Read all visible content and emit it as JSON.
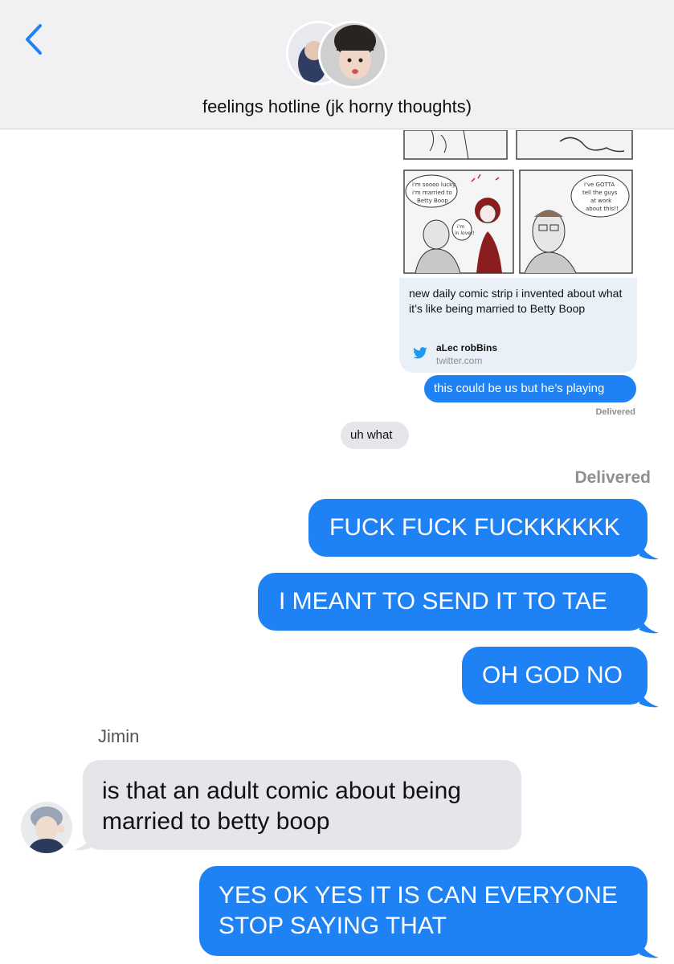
{
  "header": {
    "back_icon": "chevron-left-icon",
    "title": "feelings hotline (jk horny thoughts)",
    "accent": "#1e82f5"
  },
  "link_preview": {
    "comic_bubbles": [
      "i'm soooo lucky",
      "i'm married to",
      "Betty Boop",
      "i'm",
      "in love!!",
      "i've GOTTA",
      "tell the guys",
      "at work",
      "about this!!"
    ],
    "text": "new daily comic strip i invented about what it’s like being married to Betty Boop",
    "source": "aLec robBins",
    "domain": "twitter.com",
    "icon": "twitter-bird-icon"
  },
  "messages": {
    "m1": "this could be us but he’s playing",
    "status1": "Delivered",
    "m2": "uh what",
    "status2": "Delivered",
    "m3": "FUCK FUCK FUCKKKKKK",
    "m4": "I MEANT TO SEND IT TO TAE",
    "m5": "OH GOD NO",
    "sender": "Jimin",
    "m6_line1": "is that an adult comic about being",
    "m6_line2": "married to betty boop",
    "m7_line1": "YES OK YES IT IS CAN EVERYONE",
    "m7_line2": "STOP SAYING THAT"
  },
  "colors": {
    "sent": "#1e82f5",
    "received": "#e5e5ea",
    "header_bg": "#f1f1f3"
  }
}
